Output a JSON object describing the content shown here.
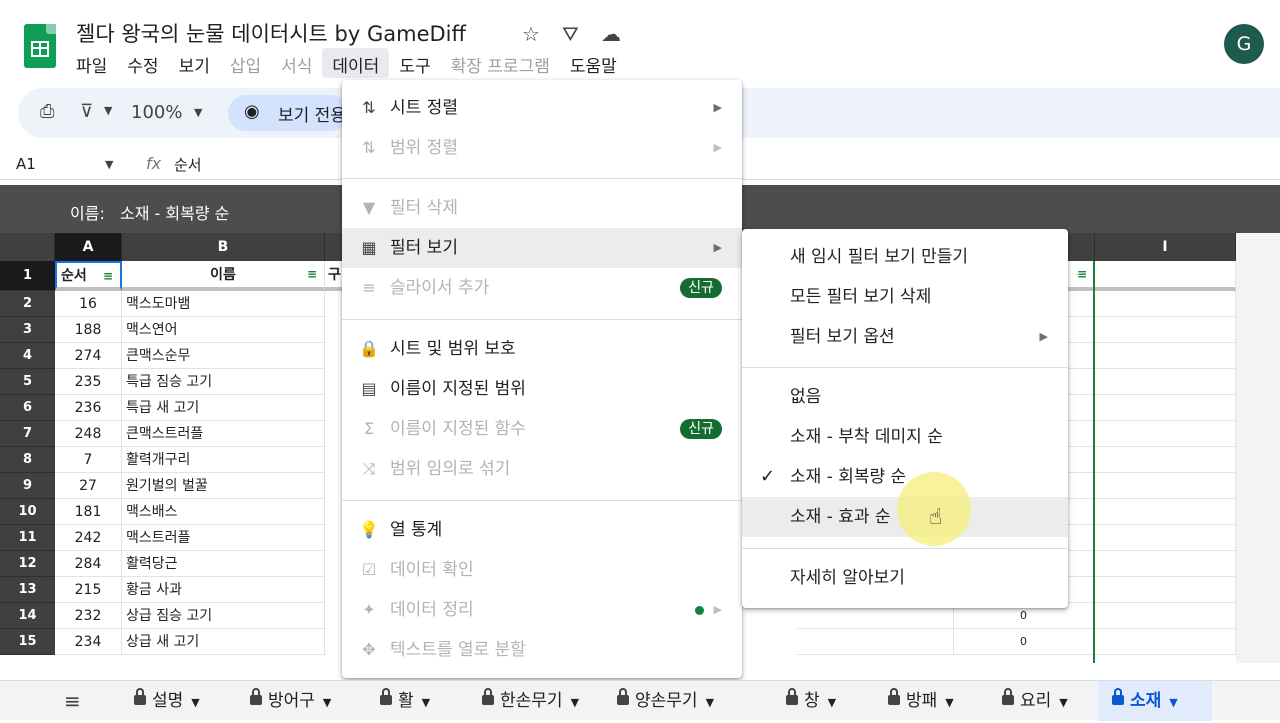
{
  "app": {
    "doc_title": "젤다 왕국의 눈물 데이터시트 by GameDiff",
    "avatar_letter": "G",
    "menus": [
      {
        "label": "파일",
        "state": "normal"
      },
      {
        "label": "수정",
        "state": "normal"
      },
      {
        "label": "보기",
        "state": "normal"
      },
      {
        "label": "삽입",
        "state": "disabled"
      },
      {
        "label": "서식",
        "state": "disabled"
      },
      {
        "label": "데이터",
        "state": "active"
      },
      {
        "label": "도구",
        "state": "normal"
      },
      {
        "label": "확장 프로그램",
        "state": "disabled"
      },
      {
        "label": "도움말",
        "state": "normal"
      }
    ]
  },
  "toolbar": {
    "zoom": "100%",
    "view_label": "보기 전용"
  },
  "formula_bar": {
    "cell_ref": "A1",
    "fx": "fx",
    "content": "순서"
  },
  "filter_view": {
    "label": "이름:",
    "name": "소재 - 회복량 순"
  },
  "grid": {
    "columns": [
      "A",
      "B",
      "I"
    ],
    "header_row": {
      "row_num": "1",
      "a": "순서",
      "b": "이름",
      "c_partial": "구"
    },
    "rows": [
      {
        "n": "2",
        "a": "16",
        "b": "맥스도마뱀",
        "i": ""
      },
      {
        "n": "3",
        "a": "188",
        "b": "맥스연어",
        "i": ""
      },
      {
        "n": "4",
        "a": "274",
        "b": "큰맥스순무",
        "i": ""
      },
      {
        "n": "5",
        "a": "235",
        "b": "특급 짐승 고기",
        "i": ""
      },
      {
        "n": "6",
        "a": "236",
        "b": "특급 새 고기",
        "i": ""
      },
      {
        "n": "7",
        "a": "248",
        "b": "큰맥스트러플",
        "i": ""
      },
      {
        "n": "8",
        "a": "7",
        "b": "활력개구리",
        "i": ""
      },
      {
        "n": "9",
        "a": "27",
        "b": "원기벌의 벌꿀",
        "i": ""
      },
      {
        "n": "10",
        "a": "181",
        "b": "맥스배스",
        "i": ""
      },
      {
        "n": "11",
        "a": "242",
        "b": "맥스트러플",
        "i": ""
      },
      {
        "n": "12",
        "a": "284",
        "b": "활력당근",
        "i": ""
      },
      {
        "n": "13",
        "a": "215",
        "b": "황금 사과",
        "i": ""
      },
      {
        "n": "14",
        "a": "232",
        "b": "상급 짐승 고기",
        "i": "0"
      },
      {
        "n": "15",
        "a": "234",
        "b": "상급 새 고기",
        "i": "0"
      }
    ]
  },
  "data_menu": {
    "items": [
      {
        "icon": "sort-icon",
        "glyph": "⇅",
        "label": "시트 정렬",
        "state": "normal",
        "arrow": true
      },
      {
        "icon": "sort-range-icon",
        "glyph": "⇅",
        "label": "범위 정렬",
        "state": "disabled",
        "arrow": true
      },
      {
        "icon": "filter-icon",
        "glyph": "▼",
        "label": "필터 삭제",
        "state": "disabled"
      },
      {
        "icon": "filter-view-icon",
        "glyph": "▦",
        "label": "필터 보기",
        "state": "hover",
        "arrow": true
      },
      {
        "icon": "slicer-icon",
        "glyph": "≡",
        "label": "슬라이서 추가",
        "state": "disabled",
        "badge": "신규"
      },
      {
        "icon": "lock-icon",
        "glyph": "🔒",
        "label": "시트 및 범위 보호",
        "state": "normal"
      },
      {
        "icon": "named-range-icon",
        "glyph": "▤",
        "label": "이름이 지정된 범위",
        "state": "normal"
      },
      {
        "icon": "sigma-icon",
        "glyph": "Σ",
        "label": "이름이 지정된 함수",
        "state": "disabled",
        "badge": "신규"
      },
      {
        "icon": "shuffle-icon",
        "glyph": "⤨",
        "label": "범위 임의로 섞기",
        "state": "disabled"
      },
      {
        "icon": "lightbulb-icon",
        "glyph": "💡",
        "label": "열 통계",
        "state": "normal"
      },
      {
        "icon": "validation-icon",
        "glyph": "☑",
        "label": "데이터 확인",
        "state": "disabled"
      },
      {
        "icon": "cleanup-icon",
        "glyph": "✦",
        "label": "데이터 정리",
        "state": "disabled",
        "dot": true,
        "arrow": true
      },
      {
        "icon": "split-icon",
        "glyph": "✥",
        "label": "텍스트를 열로 분할",
        "state": "disabled"
      }
    ]
  },
  "filter_view_submenu": {
    "items": [
      {
        "label": "새 임시 필터 보기 만들기",
        "state": "normal"
      },
      {
        "label": "모든 필터 보기 삭제",
        "state": "normal"
      },
      {
        "label": "필터 보기 옵션",
        "state": "normal",
        "arrow": true
      },
      {
        "label": "없음",
        "state": "normal"
      },
      {
        "label": "소재 - 부착 데미지 순",
        "state": "normal"
      },
      {
        "label": "소재 - 회복량 순",
        "state": "checked",
        "check": "✓"
      },
      {
        "label": "소재 - 효과 순",
        "state": "hover"
      },
      {
        "label": "자세히 알아보기",
        "state": "normal"
      }
    ]
  },
  "sheet_tabs": [
    {
      "label": "설명",
      "active": false
    },
    {
      "label": "방어구",
      "active": false
    },
    {
      "label": "활",
      "active": false
    },
    {
      "label": "한손무기",
      "active": false
    },
    {
      "label": "양손무기",
      "active": false
    },
    {
      "label": "창",
      "active": false
    },
    {
      "label": "방패",
      "active": false
    },
    {
      "label": "요리",
      "active": false
    },
    {
      "label": "소재",
      "active": true
    }
  ]
}
